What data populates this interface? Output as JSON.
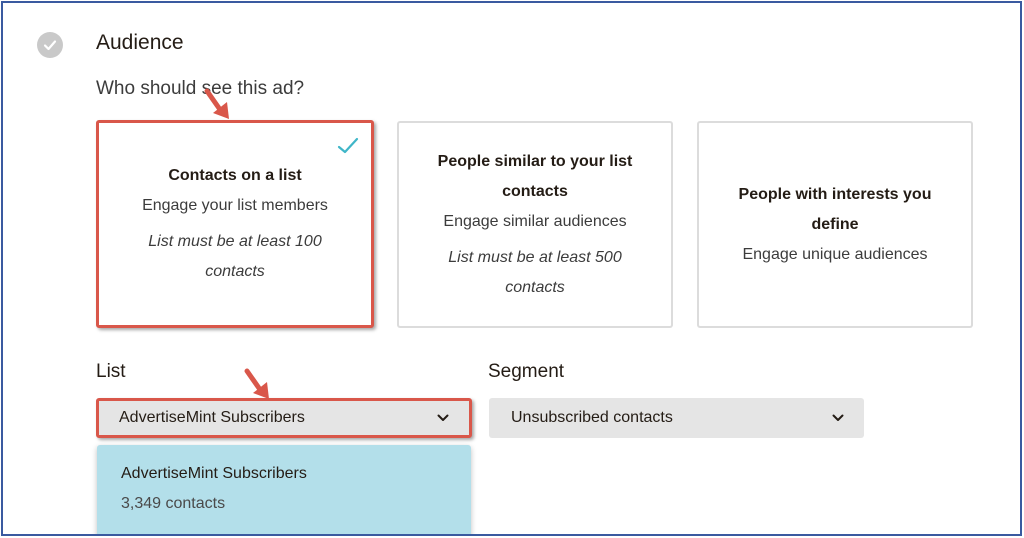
{
  "audience": {
    "title": "Audience",
    "question": "Who should see this ad?",
    "options": [
      {
        "title_line1": "Contacts on a list",
        "subtitle": "Engage your list members",
        "note_line1": "List must be at least 100",
        "note_line2": "contacts",
        "selected": true
      },
      {
        "title_line1": "People similar to your list",
        "title_line2": "contacts",
        "subtitle": "Engage similar audiences",
        "note_line1": "List must be at least 500",
        "note_line2": "contacts",
        "selected": false
      },
      {
        "title_line1": "People with interests you",
        "title_line2": "define",
        "subtitle": "Engage unique audiences",
        "selected": false
      }
    ]
  },
  "list_field": {
    "label": "List",
    "selected_value": "AdvertiseMint Subscribers"
  },
  "segment_field": {
    "label": "Segment",
    "selected_value": "Unsubscribed contacts"
  },
  "dropdown": {
    "items": [
      {
        "name": "AdvertiseMint Subscribers",
        "count": "3,349 contacts"
      }
    ]
  },
  "colors": {
    "highlight_border": "#d9574a",
    "dropdown_bg": "#b3dfea",
    "check_teal": "#3fb6c8",
    "frame_border": "#3a5aa0"
  }
}
